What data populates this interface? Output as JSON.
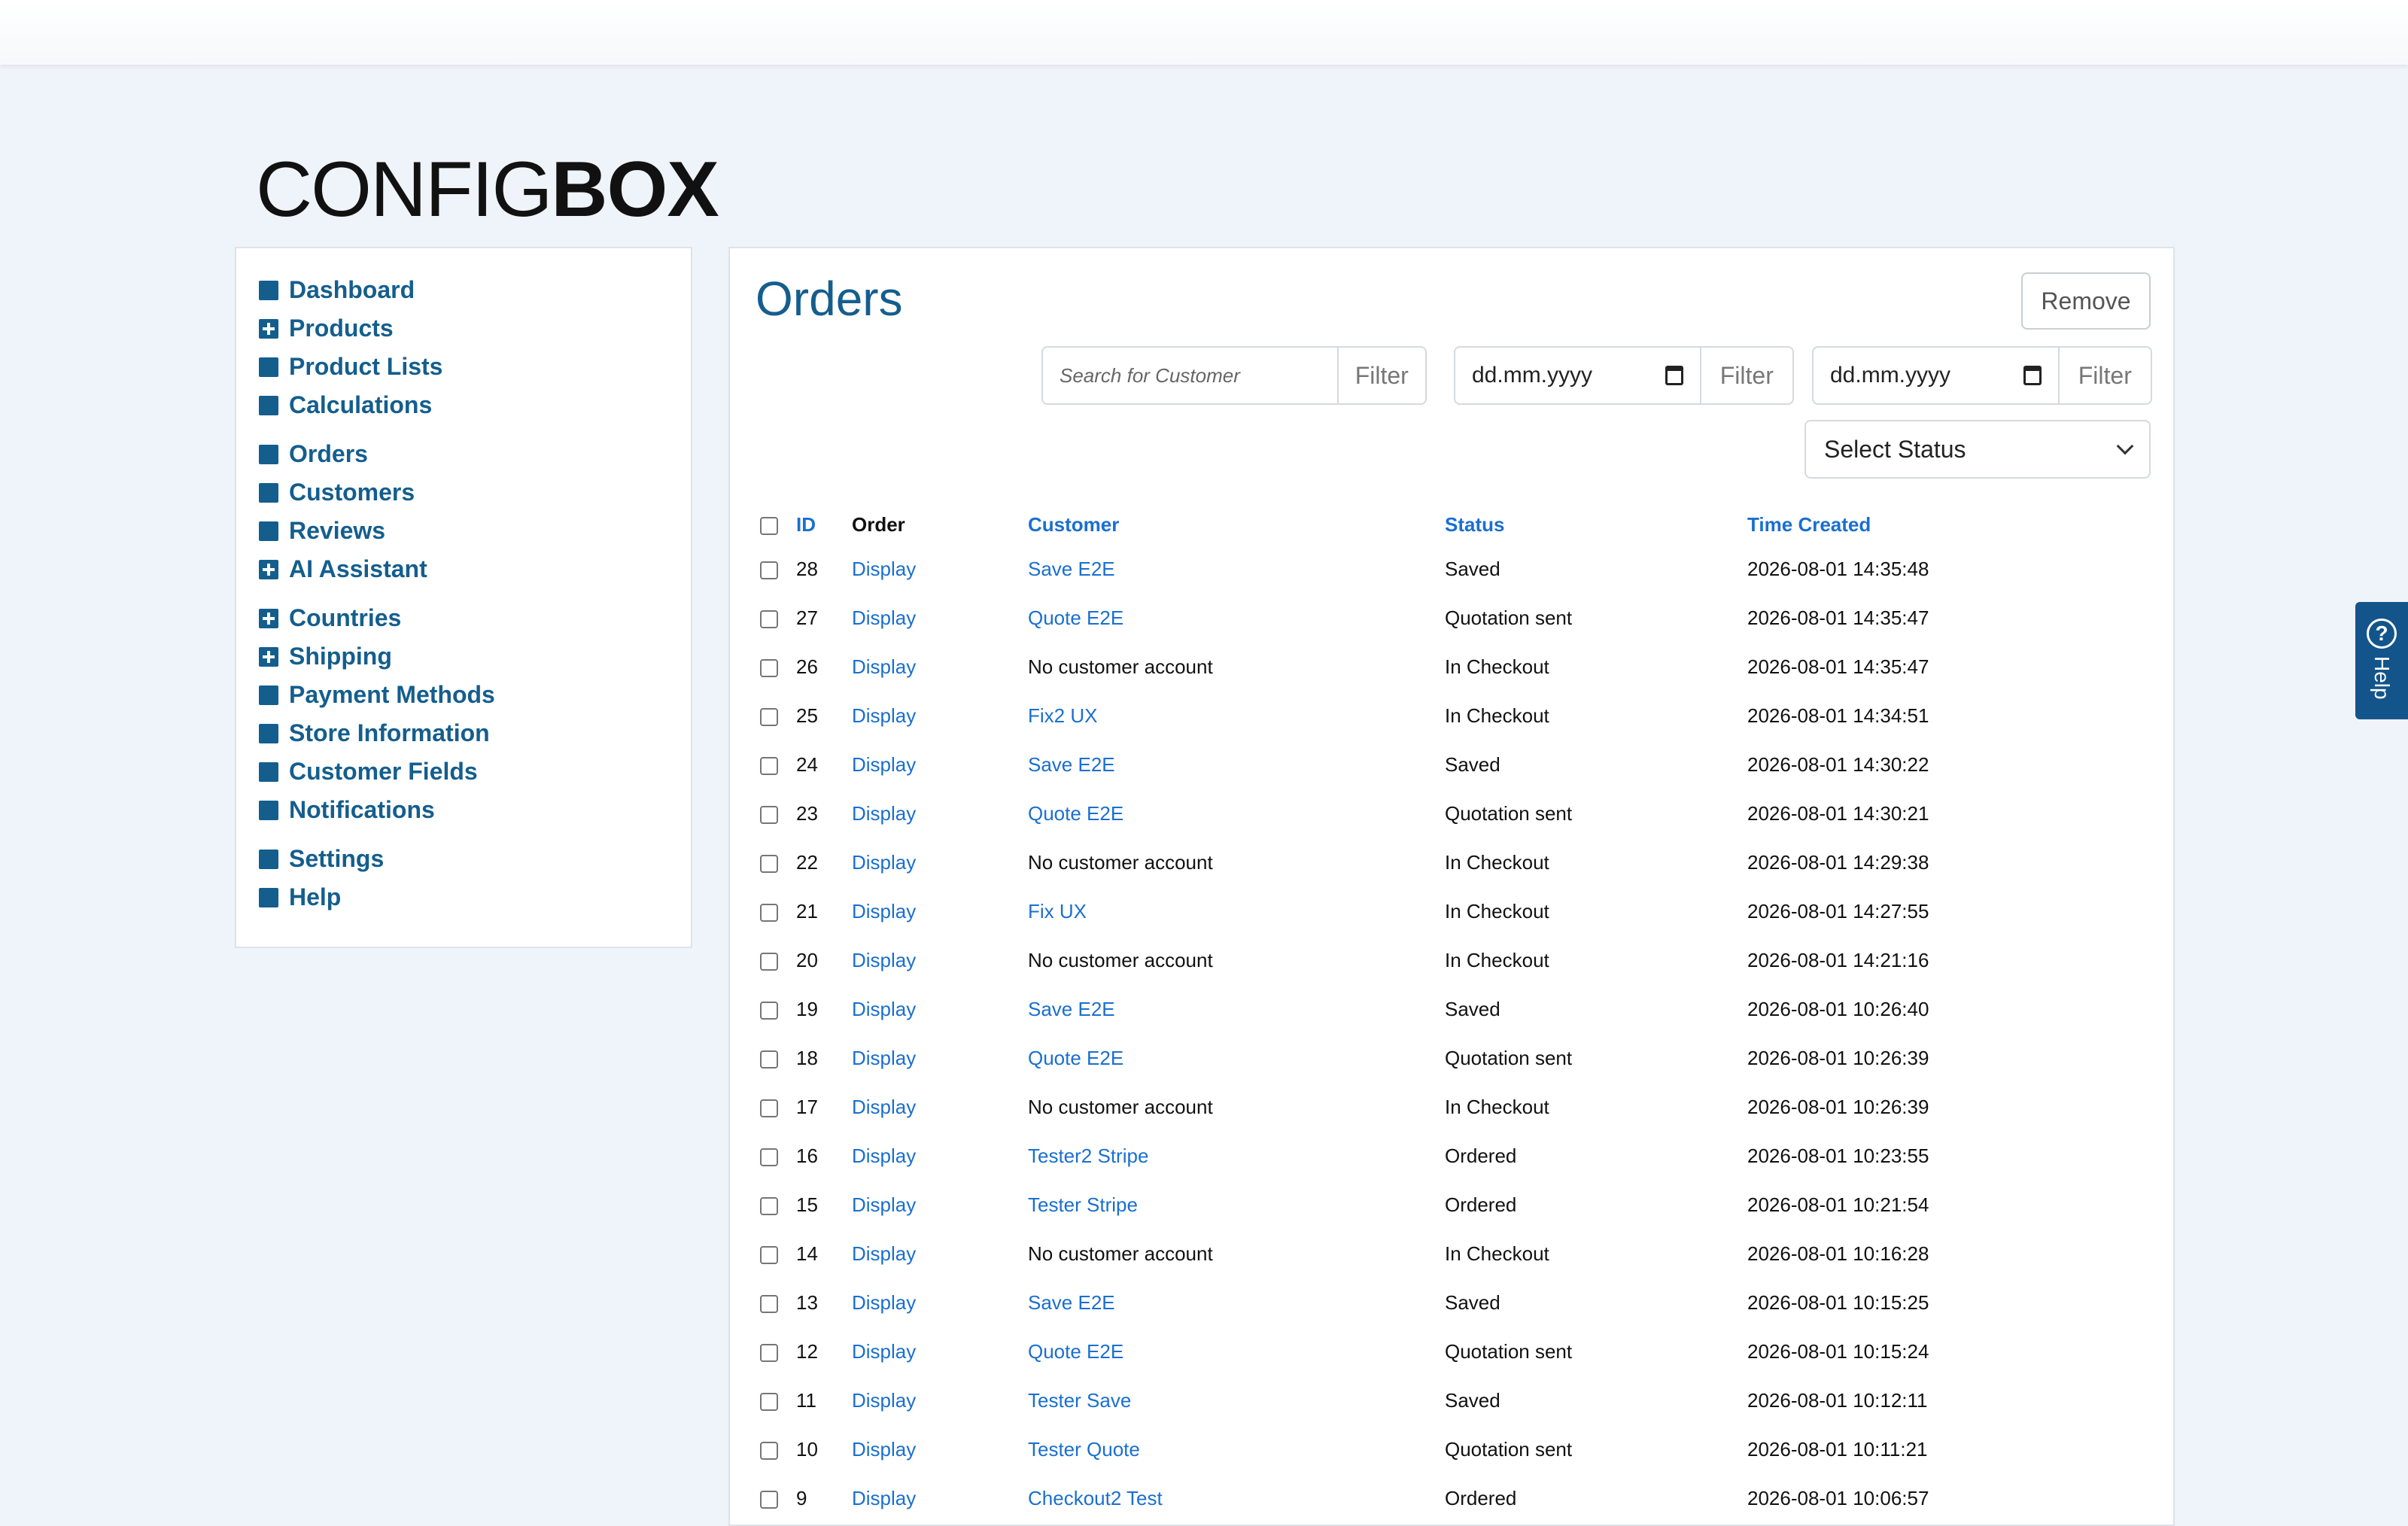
{
  "logo": {
    "thin": "CONFIG",
    "bold": "BOX"
  },
  "sidebar": {
    "groups": [
      [
        {
          "label": "Dashboard",
          "icon": "square-icon"
        },
        {
          "label": "Products",
          "icon": "plus-square-icon"
        },
        {
          "label": "Product Lists",
          "icon": "square-icon"
        },
        {
          "label": "Calculations",
          "icon": "square-icon"
        }
      ],
      [
        {
          "label": "Orders",
          "icon": "square-icon"
        },
        {
          "label": "Customers",
          "icon": "square-icon"
        },
        {
          "label": "Reviews",
          "icon": "square-icon"
        },
        {
          "label": "AI Assistant",
          "icon": "plus-square-icon"
        }
      ],
      [
        {
          "label": "Countries",
          "icon": "plus-square-icon"
        },
        {
          "label": "Shipping",
          "icon": "plus-square-icon"
        },
        {
          "label": "Payment Methods",
          "icon": "square-icon"
        },
        {
          "label": "Store Information",
          "icon": "square-icon"
        },
        {
          "label": "Customer Fields",
          "icon": "square-icon"
        },
        {
          "label": "Notifications",
          "icon": "square-icon"
        }
      ],
      [
        {
          "label": "Settings",
          "icon": "square-icon"
        },
        {
          "label": "Help",
          "icon": "square-icon"
        }
      ]
    ]
  },
  "main": {
    "title": "Orders",
    "remove_label": "Remove",
    "search_placeholder": "Search for Customer",
    "filter_label": "Filter",
    "date_placeholder": "dd.mm.yyyy",
    "status_select": "Select Status"
  },
  "table": {
    "headers": {
      "id": "ID",
      "order": "Order",
      "customer": "Customer",
      "status": "Status",
      "time": "Time Created"
    },
    "rows": [
      {
        "id": "28",
        "order": "Display",
        "customer": "Save E2E",
        "customer_link": true,
        "status": "Saved",
        "time": "2026-08-01 14:35:48"
      },
      {
        "id": "27",
        "order": "Display",
        "customer": "Quote E2E",
        "customer_link": true,
        "status": "Quotation sent",
        "time": "2026-08-01 14:35:47"
      },
      {
        "id": "26",
        "order": "Display",
        "customer": "No customer account",
        "customer_link": false,
        "status": "In Checkout",
        "time": "2026-08-01 14:35:47"
      },
      {
        "id": "25",
        "order": "Display",
        "customer": "Fix2 UX",
        "customer_link": true,
        "status": "In Checkout",
        "time": "2026-08-01 14:34:51"
      },
      {
        "id": "24",
        "order": "Display",
        "customer": "Save E2E",
        "customer_link": true,
        "status": "Saved",
        "time": "2026-08-01 14:30:22"
      },
      {
        "id": "23",
        "order": "Display",
        "customer": "Quote E2E",
        "customer_link": true,
        "status": "Quotation sent",
        "time": "2026-08-01 14:30:21"
      },
      {
        "id": "22",
        "order": "Display",
        "customer": "No customer account",
        "customer_link": false,
        "status": "In Checkout",
        "time": "2026-08-01 14:29:38"
      },
      {
        "id": "21",
        "order": "Display",
        "customer": "Fix UX",
        "customer_link": true,
        "status": "In Checkout",
        "time": "2026-08-01 14:27:55"
      },
      {
        "id": "20",
        "order": "Display",
        "customer": "No customer account",
        "customer_link": false,
        "status": "In Checkout",
        "time": "2026-08-01 14:21:16"
      },
      {
        "id": "19",
        "order": "Display",
        "customer": "Save E2E",
        "customer_link": true,
        "status": "Saved",
        "time": "2026-08-01 10:26:40"
      },
      {
        "id": "18",
        "order": "Display",
        "customer": "Quote E2E",
        "customer_link": true,
        "status": "Quotation sent",
        "time": "2026-08-01 10:26:39"
      },
      {
        "id": "17",
        "order": "Display",
        "customer": "No customer account",
        "customer_link": false,
        "status": "In Checkout",
        "time": "2026-08-01 10:26:39"
      },
      {
        "id": "16",
        "order": "Display",
        "customer": "Tester2 Stripe",
        "customer_link": true,
        "status": "Ordered",
        "time": "2026-08-01 10:23:55"
      },
      {
        "id": "15",
        "order": "Display",
        "customer": "Tester Stripe",
        "customer_link": true,
        "status": "Ordered",
        "time": "2026-08-01 10:21:54"
      },
      {
        "id": "14",
        "order": "Display",
        "customer": "No customer account",
        "customer_link": false,
        "status": "In Checkout",
        "time": "2026-08-01 10:16:28"
      },
      {
        "id": "13",
        "order": "Display",
        "customer": "Save E2E",
        "customer_link": true,
        "status": "Saved",
        "time": "2026-08-01 10:15:25"
      },
      {
        "id": "12",
        "order": "Display",
        "customer": "Quote E2E",
        "customer_link": true,
        "status": "Quotation sent",
        "time": "2026-08-01 10:15:24"
      },
      {
        "id": "11",
        "order": "Display",
        "customer": "Tester Save",
        "customer_link": true,
        "status": "Saved",
        "time": "2026-08-01 10:12:11"
      },
      {
        "id": "10",
        "order": "Display",
        "customer": "Tester Quote",
        "customer_link": true,
        "status": "Quotation sent",
        "time": "2026-08-01 10:11:21"
      },
      {
        "id": "9",
        "order": "Display",
        "customer": "Checkout2 Test",
        "customer_link": true,
        "status": "Ordered",
        "time": "2026-08-01 10:06:57"
      }
    ]
  },
  "help_tab": {
    "label": "Help",
    "glyph": "?"
  },
  "colors": {
    "nav": "#145e8e",
    "link": "#1a6fd0",
    "help_bg": "#13558a"
  }
}
